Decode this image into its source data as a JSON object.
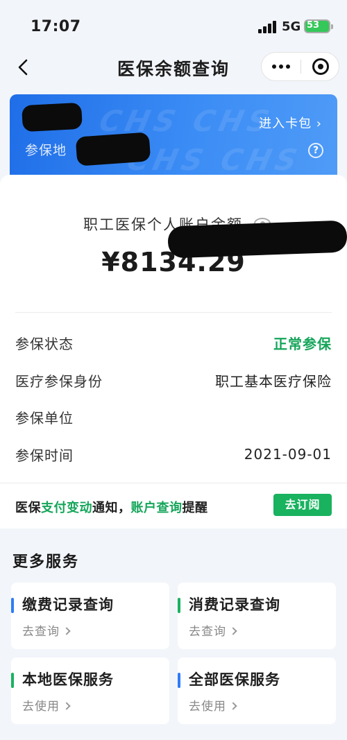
{
  "status_bar": {
    "time": "17:07",
    "network": "5G",
    "battery": "53"
  },
  "nav": {
    "title": "医保余额查询"
  },
  "card": {
    "insured_area_label": "参保地",
    "wallet_link": "进入卡包 ›",
    "help": "?"
  },
  "balance": {
    "label": "职工医保个人账户余额",
    "amount": "¥8134.29"
  },
  "info": [
    {
      "label": "参保状态",
      "value": "正常参保"
    },
    {
      "label": "医疗参保身份",
      "value": "职工基本医疗保险"
    },
    {
      "label": "参保单位",
      "value": ""
    },
    {
      "label": "参保时间",
      "value": "2021-09-01"
    }
  ],
  "notify": {
    "part1": "医保",
    "part2": "支付变动",
    "part3": "通知，",
    "part4": "账户查询",
    "part5": "提醒",
    "button": "去订阅"
  },
  "more_services": {
    "title": "更多服务",
    "items": [
      {
        "title": "缴费记录查询",
        "action": "去查询"
      },
      {
        "title": "消费记录查询",
        "action": "去查询"
      },
      {
        "title": "本地医保服务",
        "action": "去使用"
      },
      {
        "title": "全部医保服务",
        "action": "去使用"
      }
    ]
  },
  "colors": {
    "accent_green": "#19b25f",
    "accent_blue": "#2f7cf6",
    "card_blue": "#1f6ee8"
  }
}
